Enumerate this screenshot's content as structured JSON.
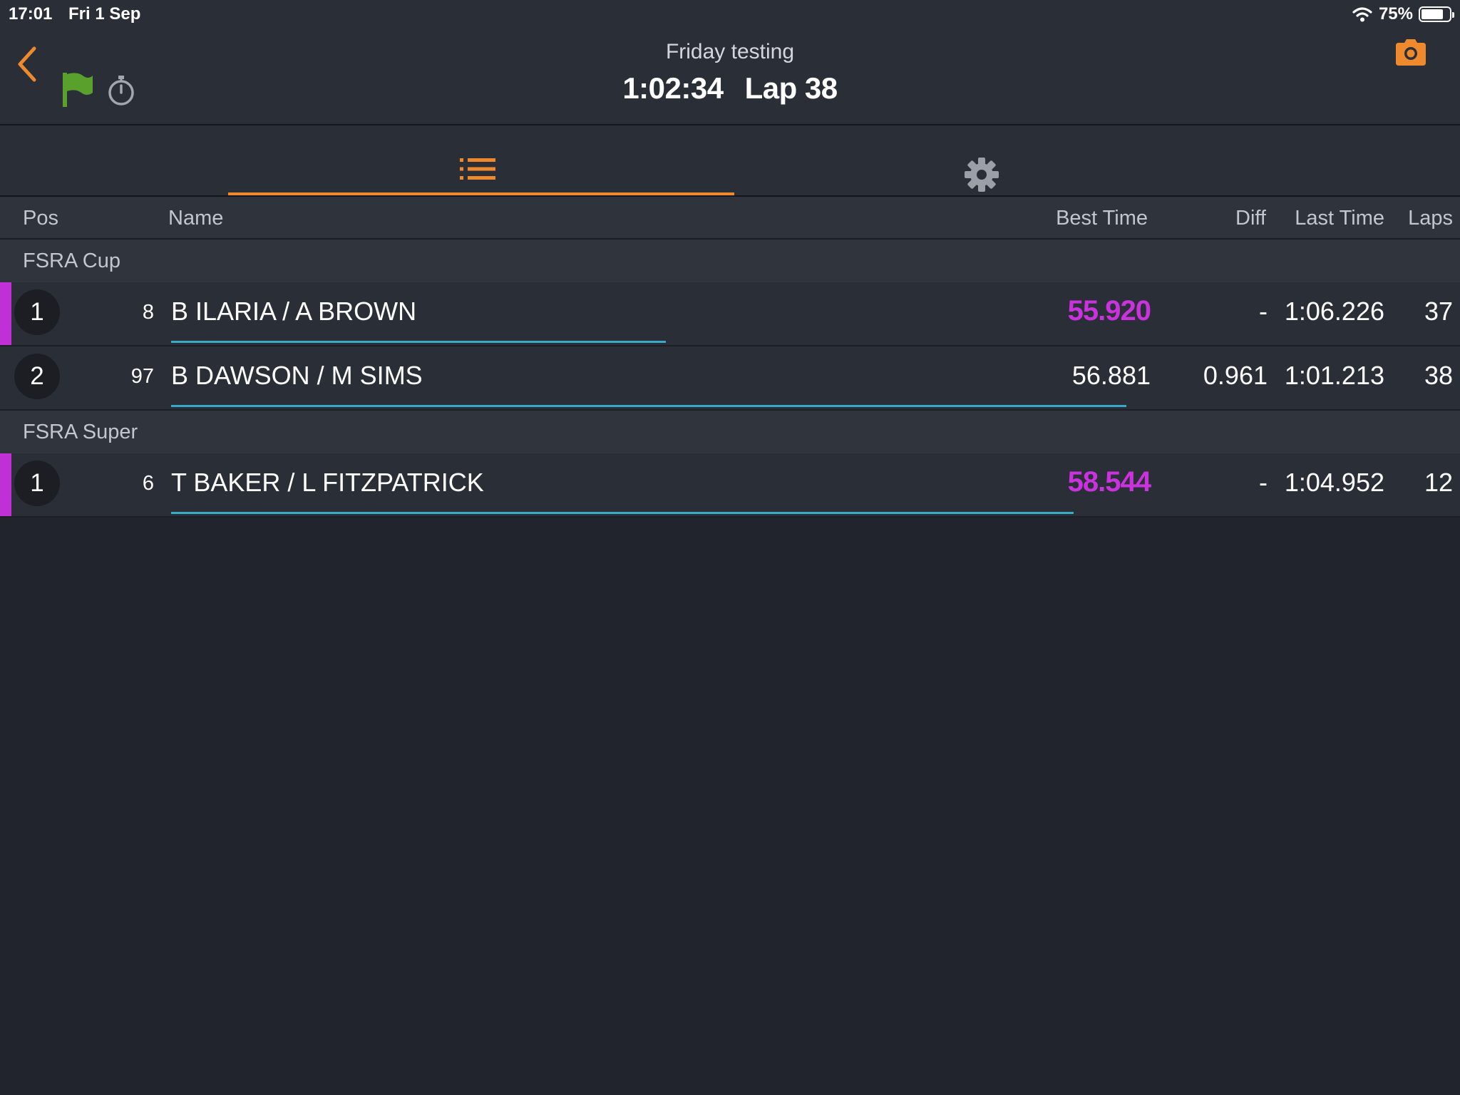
{
  "status_bar": {
    "time": "17:01",
    "date": "Fri 1 Sep",
    "battery_text": "75%",
    "battery_level": 0.75
  },
  "header": {
    "session_name": "Friday testing",
    "elapsed": "1:02:34",
    "lap": "Lap 38"
  },
  "colors": {
    "accent": "#ee8a2d",
    "fastest": "#c932dd",
    "flag_green": "#5aa02c",
    "progress": "#38a9c9"
  },
  "icons": {
    "back": "chevron-left-icon",
    "flag": "green-flag-icon",
    "stopwatch": "stopwatch-icon",
    "camera": "camera-icon",
    "list": "list-icon",
    "settings": "gear-icon"
  },
  "columns": {
    "pos": "Pos",
    "name": "Name",
    "best": "Best Time",
    "diff": "Diff",
    "last": "Last Time",
    "laps": "Laps"
  },
  "groups": [
    {
      "name": "FSRA Cup",
      "rows": [
        {
          "pos": "1",
          "num": "8",
          "name": "B ILARIA / A BROWN",
          "best": "55.920",
          "diff": "-",
          "last": "1:06.226",
          "laps": "37",
          "fastest": true,
          "progress": 0.384
        },
        {
          "pos": "2",
          "num": "97",
          "name": "B DAWSON / M SIMS",
          "best": "56.881",
          "diff": "0.961",
          "last": "1:01.213",
          "laps": "38",
          "fastest": false,
          "progress": 0.741
        }
      ]
    },
    {
      "name": "FSRA Super",
      "rows": [
        {
          "pos": "1",
          "num": "6",
          "name": "T BAKER / L FITZPATRICK",
          "best": "58.544",
          "diff": "-",
          "last": "1:04.952",
          "laps": "12",
          "fastest": true,
          "progress": 0.7
        }
      ]
    }
  ]
}
